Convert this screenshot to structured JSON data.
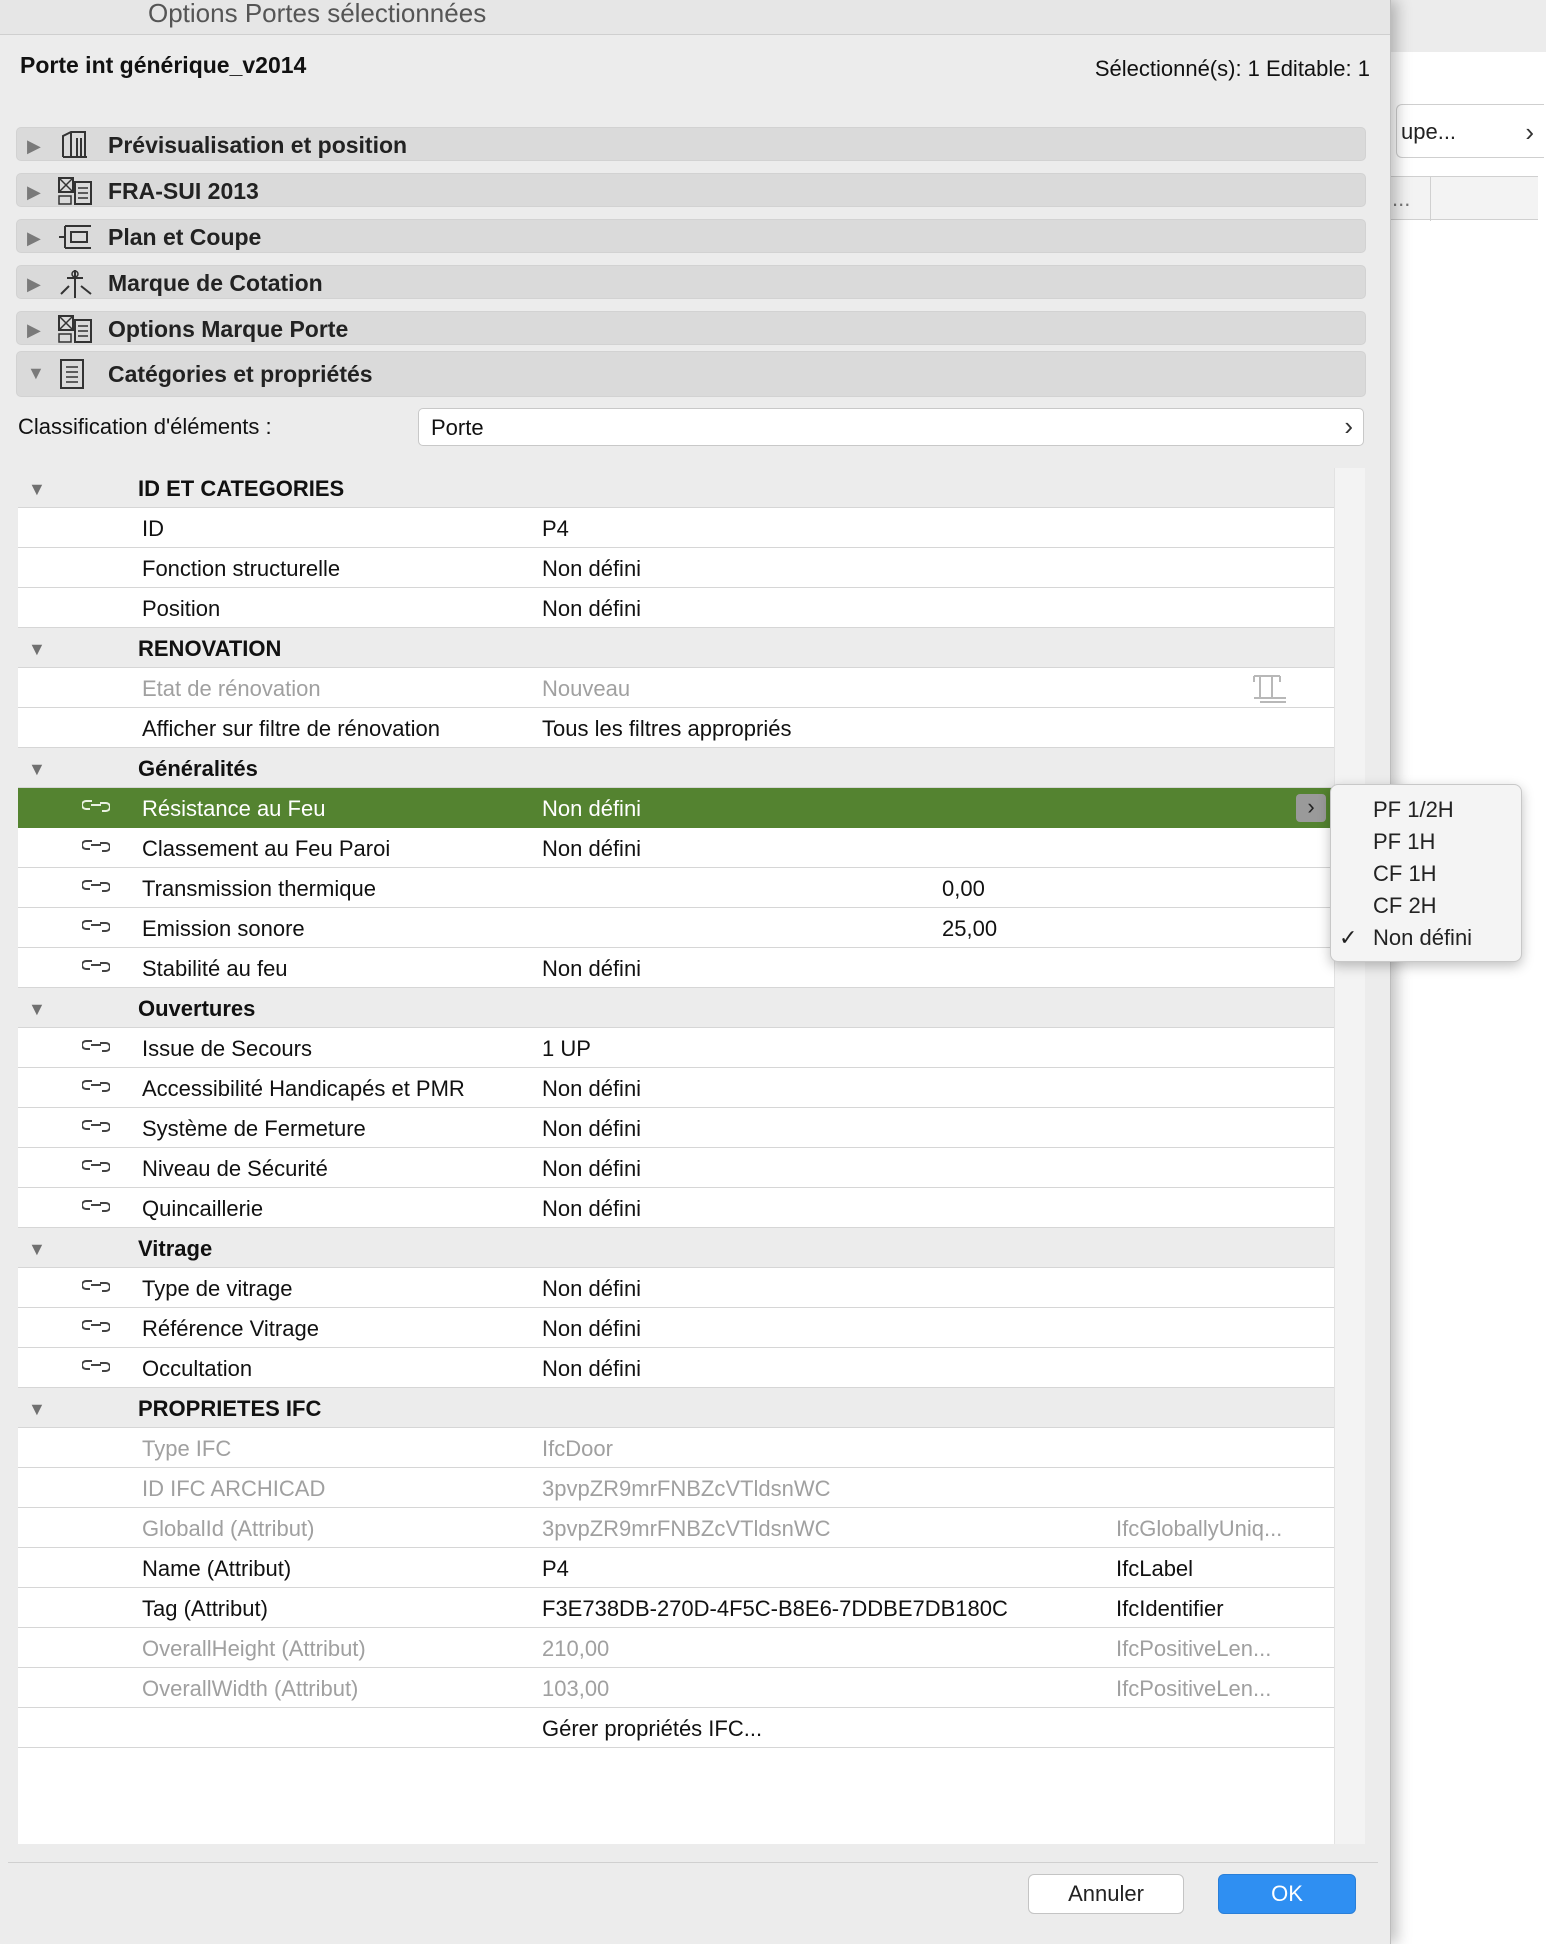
{
  "background_window": {
    "button_label": "upe...",
    "cell_label": "..."
  },
  "dialog": {
    "title": "Options Portes sélectionnées",
    "element_name": "Porte int générique_v2014",
    "selection_info": "Sélectionné(s): 1 Editable: 1"
  },
  "sections": [
    {
      "label": "Prévisualisation et position",
      "icon": "door-preview-icon"
    },
    {
      "label": "FRA-SUI 2013",
      "icon": "settings-grid-icon"
    },
    {
      "label": "Plan et Coupe",
      "icon": "plan-section-icon"
    },
    {
      "label": "Marque de Cotation",
      "icon": "dimension-marker-icon"
    },
    {
      "label": "Options Marque Porte",
      "icon": "settings-grid-icon"
    },
    {
      "label": "Catégories et propriétés",
      "icon": "document-list-icon"
    }
  ],
  "classification": {
    "label": "Classification d'éléments :",
    "value": "Porte"
  },
  "table": {
    "id_categories": {
      "title": "ID ET CATEGORIES",
      "rows": [
        {
          "name": "ID",
          "value": "P4"
        },
        {
          "name": "Fonction structurelle",
          "value": "Non défini"
        },
        {
          "name": "Position",
          "value": "Non défini"
        }
      ]
    },
    "renovation": {
      "title": "RENOVATION",
      "rows": [
        {
          "name": "Etat de rénovation",
          "value": "Nouveau"
        },
        {
          "name": "Afficher sur filtre de rénovation",
          "value": "Tous les filtres appropriés"
        }
      ]
    },
    "generalites": {
      "title": "Généralités",
      "rows": [
        {
          "name": "Résistance au Feu",
          "value": "Non défini"
        },
        {
          "name": "Classement au Feu Paroi",
          "value": "Non défini"
        },
        {
          "name": "Transmission thermique",
          "value": "0,00"
        },
        {
          "name": "Emission sonore",
          "value": "25,00"
        },
        {
          "name": "Stabilité au feu",
          "value": "Non défini"
        }
      ]
    },
    "ouvertures": {
      "title": "Ouvertures",
      "rows": [
        {
          "name": "Issue de Secours",
          "value": "1 UP"
        },
        {
          "name": "Accessibilité Handicapés et PMR",
          "value": "Non défini"
        },
        {
          "name": "Système de Fermeture",
          "value": "Non défini"
        },
        {
          "name": "Niveau de Sécurité",
          "value": "Non défini"
        },
        {
          "name": "Quincaillerie",
          "value": "Non défini"
        }
      ]
    },
    "vitrage": {
      "title": "Vitrage",
      "rows": [
        {
          "name": "Type de vitrage",
          "value": "Non défini"
        },
        {
          "name": "Référence Vitrage",
          "value": "Non défini"
        },
        {
          "name": "Occultation",
          "value": "Non défini"
        }
      ]
    },
    "ifc": {
      "title": "PROPRIETES IFC",
      "rows": [
        {
          "name": "Type IFC",
          "value": "IfcDoor",
          "type": ""
        },
        {
          "name": "ID IFC ARCHICAD",
          "value": "3pvpZR9mrFNBZcVTldsnWC",
          "type": ""
        },
        {
          "name": "GlobalId (Attribut)",
          "value": "3pvpZR9mrFNBZcVTldsnWC",
          "type": "IfcGloballyUniq..."
        },
        {
          "name": "Name (Attribut)",
          "value": "P4",
          "type": "IfcLabel"
        },
        {
          "name": "Tag (Attribut)",
          "value": "F3E738DB-270D-4F5C-B8E6-7DDBE7DB180C",
          "type": "IfcIdentifier"
        },
        {
          "name": "OverallHeight (Attribut)",
          "value": "210,00",
          "type": "IfcPositiveLen..."
        },
        {
          "name": "OverallWidth (Attribut)",
          "value": "103,00",
          "type": "IfcPositiveLen..."
        }
      ],
      "manage_label": "Gérer propriétés IFC..."
    }
  },
  "dropdown": {
    "options": [
      "PF 1/2H",
      "PF 1H",
      "CF 1H",
      "CF 2H",
      "Non défini"
    ],
    "selected": "Non défini",
    "check_mark": "✓"
  },
  "buttons": {
    "cancel": "Annuler",
    "ok": "OK"
  },
  "colors": {
    "selected_row": "#548330",
    "ok_button": "#2f8ff2"
  }
}
